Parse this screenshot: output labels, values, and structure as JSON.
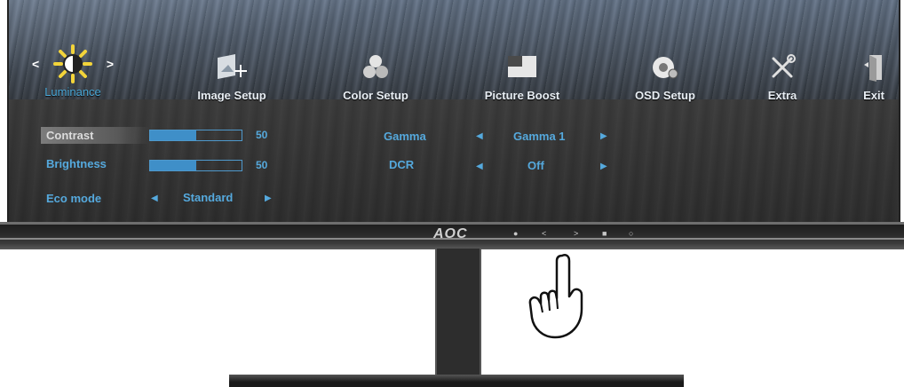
{
  "menu": {
    "items": [
      {
        "label": "Luminance",
        "icon": "sun-icon",
        "active": true
      },
      {
        "label": "Image Setup",
        "icon": "image-setup-icon"
      },
      {
        "label": "Color Setup",
        "icon": "color-setup-icon"
      },
      {
        "label": "Picture Boost",
        "icon": "picture-boost-icon"
      },
      {
        "label": "OSD Setup",
        "icon": "osd-setup-icon"
      },
      {
        "label": "Extra",
        "icon": "tools-icon"
      },
      {
        "label": "Exit",
        "icon": "exit-door-icon"
      }
    ]
  },
  "settings": {
    "contrast": {
      "label": "Contrast",
      "value": "50",
      "level": 0.5
    },
    "brightness": {
      "label": "Brightness",
      "value": "50",
      "level": 0.5
    },
    "eco_mode": {
      "label": "Eco mode",
      "value": "Standard"
    },
    "gamma": {
      "label": "Gamma",
      "value": "Gamma 1"
    },
    "dcr": {
      "label": "DCR",
      "value": "Off"
    }
  },
  "bezel": {
    "logo": "AOC"
  },
  "colors": {
    "accent": "#55a9dd",
    "bar_fill": "#3f8fc8",
    "active_label": "#4aa8d8"
  }
}
